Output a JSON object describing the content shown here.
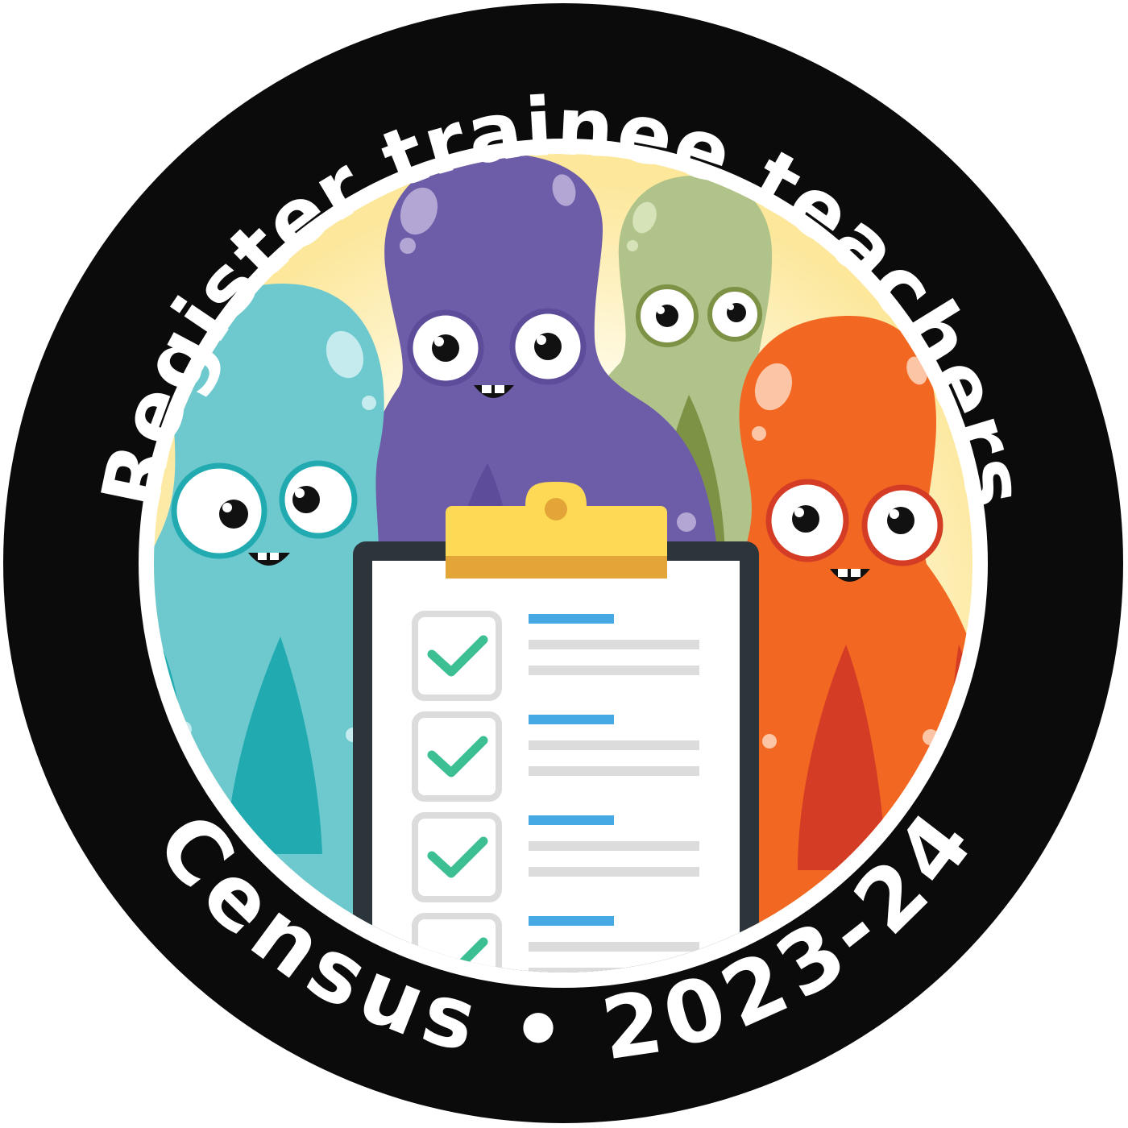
{
  "badge": {
    "top_text": "Register trainee teachers",
    "bottom_left_text": "Census",
    "separator": "•",
    "bottom_right_text": "2023-24"
  },
  "colors": {
    "ring": "#0b0b0b",
    "inner_border": "#ffffff",
    "glow": "#fce79a",
    "teal": "#6ec9cf",
    "teal_dark": "#21abb0",
    "purple": "#6d5ca8",
    "purple_dark": "#5d4c9a",
    "green": "#b0c38a",
    "green_dark": "#7e9246",
    "orange": "#f26722",
    "orange_dark": "#d43c25",
    "clipboard": "#2c353c",
    "clip": "#fdd955",
    "check": "#3dbf94",
    "line_blue": "#47a9e3",
    "line_grey": "#dcdcdc"
  },
  "clipboard": {
    "items": [
      {
        "checked": true
      },
      {
        "checked": true
      },
      {
        "checked": true
      },
      {
        "checked": true
      }
    ]
  }
}
